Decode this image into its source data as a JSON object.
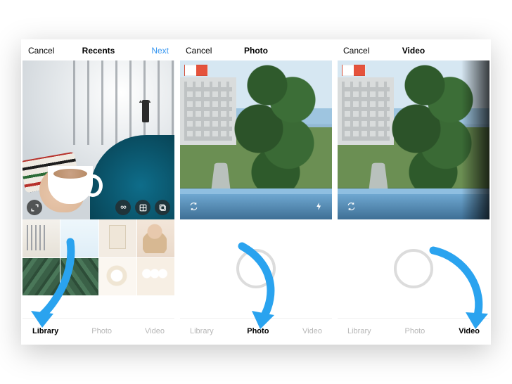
{
  "screens": [
    {
      "id": "library",
      "header": {
        "cancel": "Cancel",
        "title": "Recents",
        "next": "Next"
      },
      "icons": {
        "expand": "expand-icon",
        "boomerang": "infinity-icon",
        "layout": "grid-icon",
        "multi": "multi-select-icon"
      },
      "tabs": {
        "library": "Library",
        "photo": "Photo",
        "video": "Video",
        "active": "library"
      }
    },
    {
      "id": "photo",
      "header": {
        "cancel": "Cancel",
        "title": "Photo",
        "next": ""
      },
      "icons": {
        "switch": "switch-camera-icon",
        "flash": "flash-icon"
      },
      "tabs": {
        "library": "Library",
        "photo": "Photo",
        "video": "Video",
        "active": "photo"
      }
    },
    {
      "id": "video",
      "header": {
        "cancel": "Cancel",
        "title": "Video",
        "next": ""
      },
      "icons": {
        "switch": "switch-camera-icon"
      },
      "tabs": {
        "library": "Library",
        "photo": "Photo",
        "video": "Video",
        "active": "video"
      }
    }
  ],
  "annotation_color": "#2aa3ef"
}
